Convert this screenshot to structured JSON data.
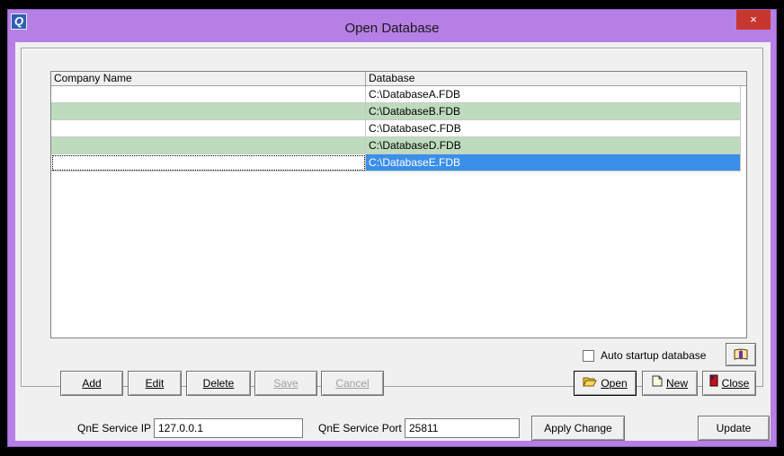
{
  "window": {
    "title": "Open Database",
    "app_icon_letter": "Q",
    "close_glyph": "×"
  },
  "grid": {
    "columns": [
      "Company Name",
      "Database"
    ],
    "rows": [
      {
        "company": "",
        "database": "C:\\DatabaseA.FDB"
      },
      {
        "company": "",
        "database": "C:\\DatabaseB.FDB"
      },
      {
        "company": "",
        "database": "C:\\DatabaseC.FDB"
      },
      {
        "company": "",
        "database": "C:\\DatabaseD.FDB"
      },
      {
        "company": "",
        "database": "C:\\DatabaseE.FDB"
      }
    ],
    "selected_row": 4
  },
  "auto_startup": {
    "label": "Auto startup database",
    "checked": false,
    "icon": "book-icon"
  },
  "buttons": {
    "add": "Add",
    "edit": "Edit",
    "delete": "Delete",
    "save": "Save",
    "cancel": "Cancel",
    "open": "Open",
    "new": "New",
    "close": "Close"
  },
  "service": {
    "ip_label": "QnE Service IP",
    "ip_value": "127.0.0.1",
    "port_label": "QnE Service Port",
    "port_value": "25811",
    "apply_label": "Apply Change",
    "update_label": "Update"
  },
  "colors": {
    "alt_row": "#bedbbe",
    "selected": "#3a8fe8",
    "window_frame": "#b57fe6"
  }
}
